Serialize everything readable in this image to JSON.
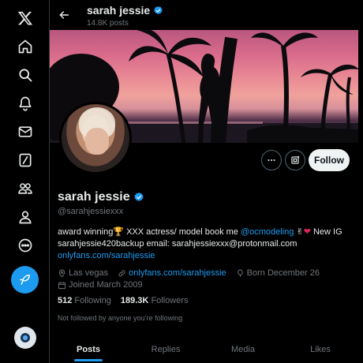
{
  "nav": {
    "items": [
      {
        "icon": "x-logo-icon"
      },
      {
        "icon": "home-icon"
      },
      {
        "icon": "search-icon"
      },
      {
        "icon": "notifications-bell-icon"
      },
      {
        "icon": "messages-envelope-icon"
      },
      {
        "icon": "grok-slash-icon"
      },
      {
        "icon": "communities-icon"
      },
      {
        "icon": "profile-person-icon"
      },
      {
        "icon": "more-circle-icon"
      }
    ],
    "compose_icon": "compose-feather-icon"
  },
  "header": {
    "name": "sarah jessie",
    "post_count": "14.8K posts"
  },
  "profile": {
    "name": "sarah jessie",
    "handle": "@sarahjessiexxx",
    "follow_label": "Follow",
    "bio": {
      "part1": "award winning",
      "trophy": "🏆",
      "part2": " XXX actress/ model book me ",
      "mention": "@ocmodeling",
      "part3": " ✌",
      "heart": "❤",
      "part4": " New IG sarahjessie420backup email: sarahjessiexxx@protonmail.com ",
      "link": "onlyfans.com/sarahjessie"
    },
    "location": "Las vegas",
    "website": "onlyfans.com/sarahjessie",
    "born": "Born December 26",
    "joined": "Joined March 2009",
    "following_count": "512",
    "following_label": "Following",
    "followers_count": "189.3K",
    "followers_label": "Followers",
    "not_followed": "Not followed by anyone you’re following"
  },
  "tabs": [
    {
      "label": "Posts",
      "active": true
    },
    {
      "label": "Replies",
      "active": false
    },
    {
      "label": "Media",
      "active": false
    },
    {
      "label": "Likes",
      "active": false
    }
  ],
  "colors": {
    "accent": "#1d9bf0",
    "background": "#000000",
    "text": "#e7e9ea",
    "muted": "#71767b"
  }
}
